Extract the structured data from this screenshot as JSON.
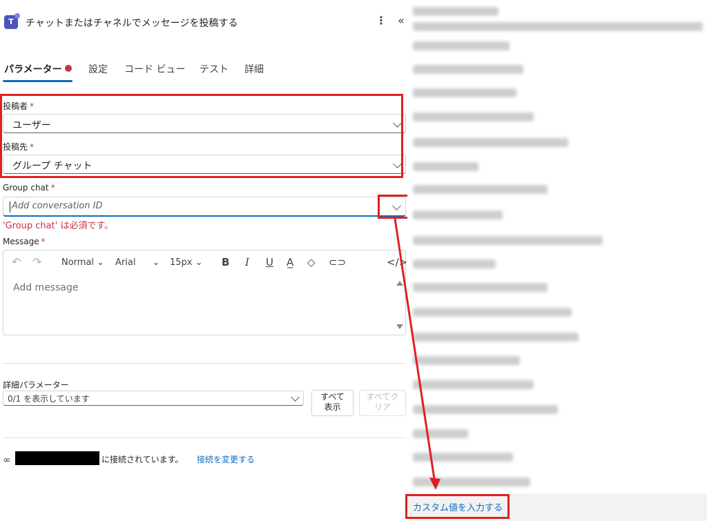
{
  "header": {
    "title": "チャットまたはチャネルでメッセージを投稿する",
    "more_icon": "kebab-icon",
    "collapse_icon": "double-chevron-left-icon"
  },
  "tabs": [
    {
      "label": "パラメーター",
      "active": true
    },
    {
      "label": "設定"
    },
    {
      "label": "コード ビュー"
    },
    {
      "label": "テスト"
    },
    {
      "label": "詳細"
    }
  ],
  "fields": {
    "poster": {
      "label": "投稿者",
      "required": "*",
      "value": "ユーザー"
    },
    "post_in": {
      "label": "投稿先",
      "required": "*",
      "value": "グループ チャット"
    },
    "group_chat": {
      "label": "Group chat",
      "required": "*",
      "placeholder": "Add conversation ID",
      "error": "'Group chat' は必須です。"
    },
    "message": {
      "label": "Message",
      "required": "*",
      "placeholder": "Add message",
      "toolbar": {
        "style": "Normal",
        "font": "Arial",
        "size": "15px"
      }
    }
  },
  "advanced": {
    "label": "詳細パラメーター",
    "value": "0/1 を表示しています",
    "show_all_line1": "すべて",
    "show_all_line2": "表示",
    "clear_all_line1": "すべてク",
    "clear_all_line2": "リア"
  },
  "connection": {
    "status_text": "に接続されています。",
    "change_link": "接続を変更する"
  },
  "dropdown": {
    "custom_value": "カスタム値を入力する"
  },
  "colors": {
    "accent": "#0f6cbd",
    "error": "#c4314b",
    "highlight": "#e02020"
  }
}
